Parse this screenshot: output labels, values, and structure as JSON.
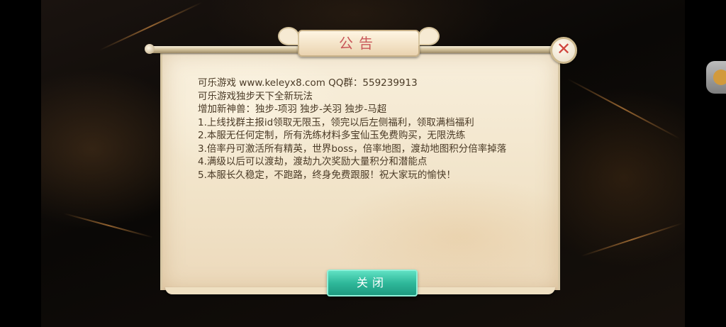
{
  "dialog": {
    "title": "公告",
    "close_icon": "close-x-icon",
    "lines": [
      "可乐游戏 www.keleyx8.com  QQ群：559239913",
      "可乐游戏独步天下全新玩法",
      "增加新神兽：独步-项羽   独步-关羽  独步-马超",
      "1.上线找群主报id领取无限玉，领完以后左侧福利，领取满档福利",
      "2.本服无任何定制，所有洗练材料多宝仙玉免费购买，无限洗练",
      "3.倍率丹可激活所有精英，世界boss，倍率地图，渡劫地图积分倍率掉落",
      "4.满级以后可以渡劫，渡劫九次奖励大量积分和潜能点",
      "5.本服长久稳定，不跑路，终身免费跟服！祝大家玩的愉快！"
    ],
    "close_button_label": "关闭"
  },
  "side": {
    "orb_icon": "side-menu-orb-icon"
  },
  "colors": {
    "title_red": "#c9585a",
    "button_teal": "#2fb89a",
    "text_brown": "#4a3a26"
  }
}
